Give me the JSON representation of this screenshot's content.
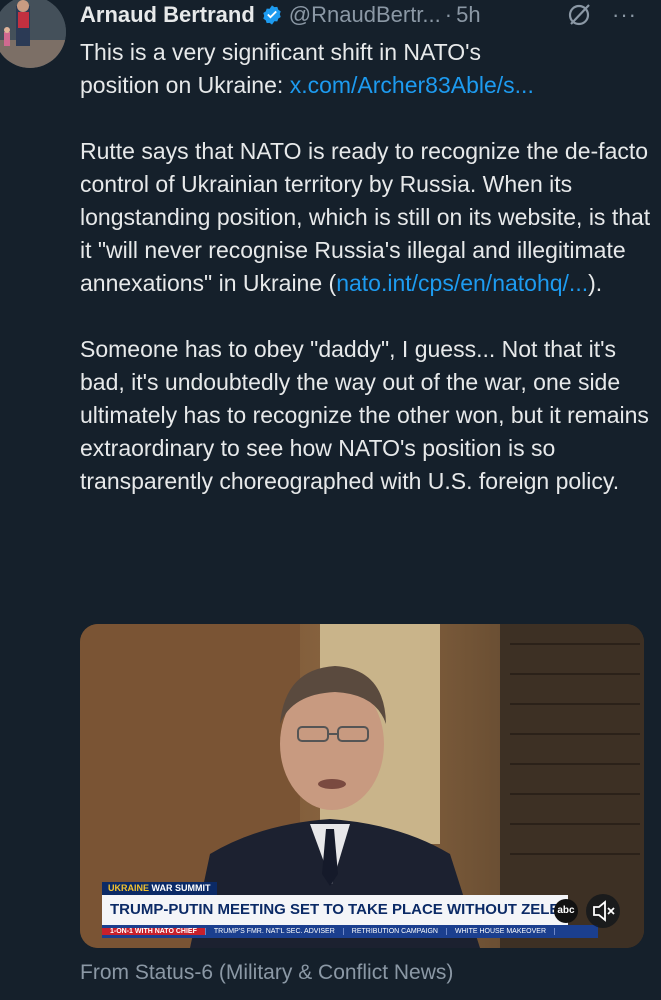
{
  "author": {
    "name": "Arnaud Bertrand",
    "handle": "@RnaudBertr...",
    "separator": "·",
    "time": "5h",
    "more_label": "···"
  },
  "tweet": {
    "line1": "This is a very significant shift in NATO's",
    "line2_text": "position on Ukraine: ",
    "line2_link": "x.com/Archer83Able/s...",
    "para2_a": "Rutte says that NATO is ready to recognize the de-facto control of Ukrainian territory by Russia. When its longstanding position, which is still on its website, is that it \"will never recognise Russia's illegal and illegitimate annexations\" in Ukraine (",
    "para2_link": "nato.int/cps/en/natohq/...",
    "para2_b": ").",
    "para3": "Someone has to obey \"daddy\", I guess... Not that it's bad, it's undoubtedly the way out of the war, one side ultimately has to recognize the other won, but it remains extraordinary to see how NATO's position is so transparently choreographed with U.S. foreign policy."
  },
  "media": {
    "chyron_top_a": "UKRAINE",
    "chyron_top_b": "WAR SUMMIT",
    "chyron_main": "TRUMP-PUTIN MEETING SET TO TAKE PLACE WITHOUT ZELENSKYY",
    "network": "abc",
    "ticker": [
      "1-ON-1 WITH NATO CHIEF",
      "TRUMP'S FMR. NAT'L SEC. ADVISER",
      "RETRIBUTION CAMPAIGN",
      "WHITE HOUSE MAKEOVER"
    ]
  },
  "footer": {
    "source": "From Status-6 (Military & Conflict News)"
  },
  "colors": {
    "background": "#15202b",
    "link": "#1d9bf0",
    "muted": "#8b98a5",
    "verified": "#1d9bf0"
  }
}
